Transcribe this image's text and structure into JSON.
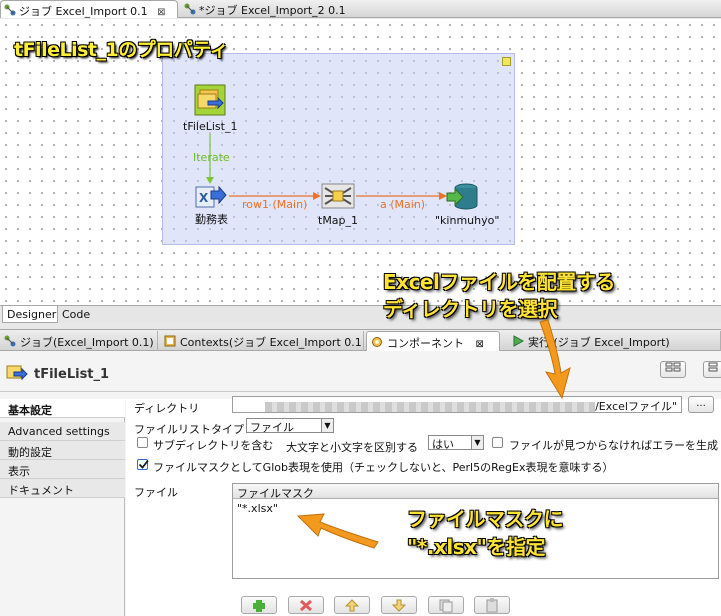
{
  "editor_tabs": [
    {
      "label": "ジョブ Excel_Import 0.1",
      "close": "⊠"
    },
    {
      "label": "*ジョブ Excel_Import_2 0.1"
    }
  ],
  "canvas": {
    "title_overlay": "tFileList_1のプロパティ",
    "components": {
      "filelist": "tFileList_1",
      "excel": "勤務表",
      "tmap": "tMap_1",
      "output": "\"kinmuhyo\""
    },
    "links": {
      "iterate": "Iterate",
      "row1": "row1 (Main)",
      "a": "a (Main)"
    }
  },
  "designer_tabs": [
    "Designer",
    "Code"
  ],
  "view_tabs": [
    {
      "label": "ジョブ(Excel_Import 0.1)"
    },
    {
      "label": "Contexts(ジョブ Excel_Import 0.1"
    },
    {
      "label": "コンポーネント",
      "close": "⊠"
    },
    {
      "label": "実行 (ジョブ Excel_Import)"
    }
  ],
  "panel": {
    "title": "tFileList_1",
    "side_items": [
      "基本設定",
      "Advanced settings",
      "動的設定",
      "表示",
      "ドキュメント"
    ],
    "directory_label": "ディレクトリ",
    "directory_value": "/Excelファイル\"",
    "browse_button": "...",
    "filelist_type_label": "ファイルリストタイプ",
    "filelist_type_value": "ファイル",
    "subdir_label": "サブディレクトリを含む",
    "case_label": "大文字と小文字を区別する",
    "case_value": "はい",
    "error_label": "ファイルが見つからなければエラーを生成",
    "glob_label": "ファイルマスクとしてGlob表現を使用（チェックしないと、Perl5のRegEx表現を意味する）",
    "file_label": "ファイル",
    "table_header": "ファイルマスク",
    "table_value": "\"*.xlsx\""
  },
  "callouts": {
    "directory_line1": "Excelファイルを配置する",
    "directory_line2": "ディレクトリを選択",
    "mask_line1": "ファイルマスクに",
    "mask_line2": "\"*.xlsx\"を指定"
  },
  "colors": {
    "callout_text": "#ffe433",
    "arrow": "#f39a1e",
    "subjob_bg": "#c8d0f5",
    "iterate_link": "#7cc634",
    "main_link": "#e8732a"
  }
}
